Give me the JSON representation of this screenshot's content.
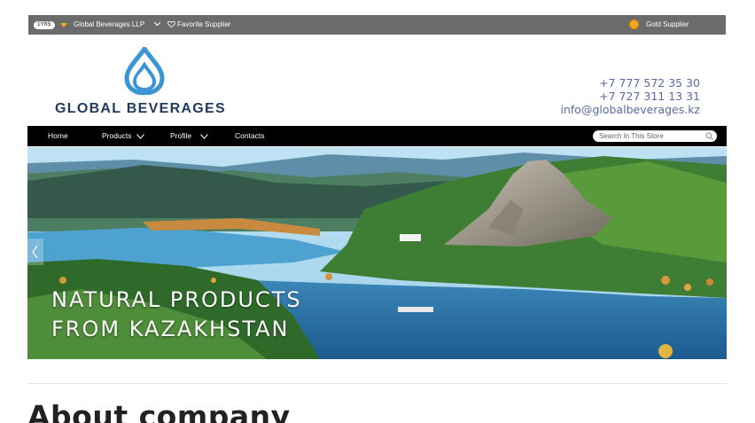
{
  "topbar": {
    "years_badge": "1YRS",
    "company_name": "Global Beverages LLP",
    "favorite_label": "Favorite Supplier",
    "supplier_status": "Gold Supplier",
    "icons": [
      "medal-icon",
      "chevron-down-icon",
      "heart-icon",
      "gold-supplier-icon"
    ]
  },
  "header": {
    "logo_text": "GLOBAL BEVERAGES",
    "phone_1": "+7 777 572 35 30",
    "phone_2": "+7 727 311 13 31",
    "email": "info@globalbeverages.kz",
    "brand_color": "#1f3a5c",
    "logo_color": "#3b95d3",
    "contact_color": "#5a6aa3"
  },
  "nav": {
    "items": [
      {
        "label": "Home",
        "has_dropdown": false
      },
      {
        "label": "Products",
        "has_dropdown": true
      },
      {
        "label": "Profile",
        "has_dropdown": true
      },
      {
        "label": "Contacts",
        "has_dropdown": false
      }
    ],
    "search_placeholder": "Search In This Store"
  },
  "hero": {
    "caption_line_1": "NATURAL PRODUCTS",
    "caption_line_2": "FROM KAZAKHSTAN"
  },
  "about": {
    "heading": "About company"
  }
}
